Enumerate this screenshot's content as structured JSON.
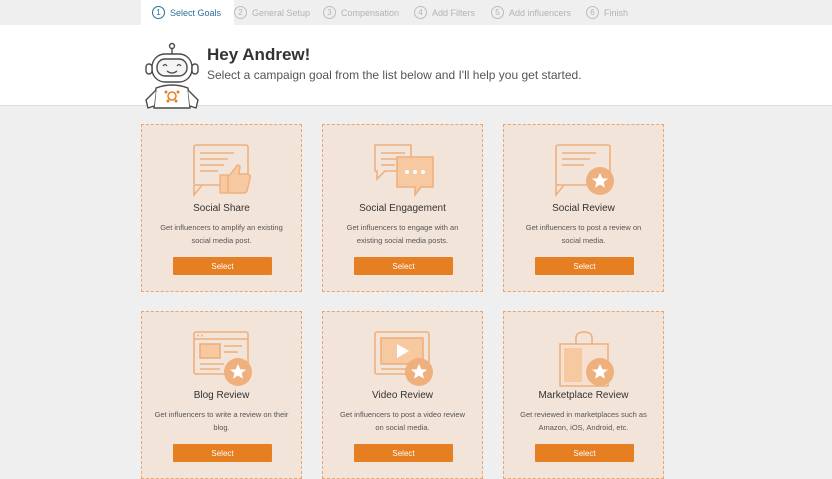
{
  "steps": [
    {
      "num": "1",
      "label": "Select Goals"
    },
    {
      "num": "2",
      "label": "General Setup"
    },
    {
      "num": "3",
      "label": "Compensation"
    },
    {
      "num": "4",
      "label": "Add Filters"
    },
    {
      "num": "5",
      "label": "Add influencers"
    },
    {
      "num": "6",
      "label": "Finish"
    }
  ],
  "hero": {
    "title": "Hey Andrew!",
    "subtitle": "Select a campaign goal from the list below and I'll help you get started."
  },
  "cards": [
    {
      "title": "Social Share",
      "desc": "Get influencers to amplify an existing social media post.",
      "button": "Select",
      "icon": "thumbs-up-post-icon"
    },
    {
      "title": "Social Engagement",
      "desc": "Get influencers to engage with an existing social media posts.",
      "button": "Select",
      "icon": "chat-bubbles-icon"
    },
    {
      "title": "Social Review",
      "desc": "Get influencers to post a review on social media.",
      "button": "Select",
      "icon": "star-review-icon"
    },
    {
      "title": "Blog Review",
      "desc": "Get influencers to write a review on their blog.",
      "button": "Select",
      "icon": "blog-star-icon"
    },
    {
      "title": "Video Review",
      "desc": "Get influencers to post a video review on social media.",
      "button": "Select",
      "icon": "video-star-icon"
    },
    {
      "title": "Marketplace Review",
      "desc": "Get reviewed in marketplaces such as Amazon, iOS, Android, etc.",
      "button": "Select",
      "icon": "shopping-bag-star-icon"
    }
  ],
  "colors": {
    "accent": "#e67e22",
    "card_bg": "#f3e4d9",
    "card_border": "#e8a772",
    "icon": "#eeb07d",
    "active_step": "#2a6f97"
  }
}
